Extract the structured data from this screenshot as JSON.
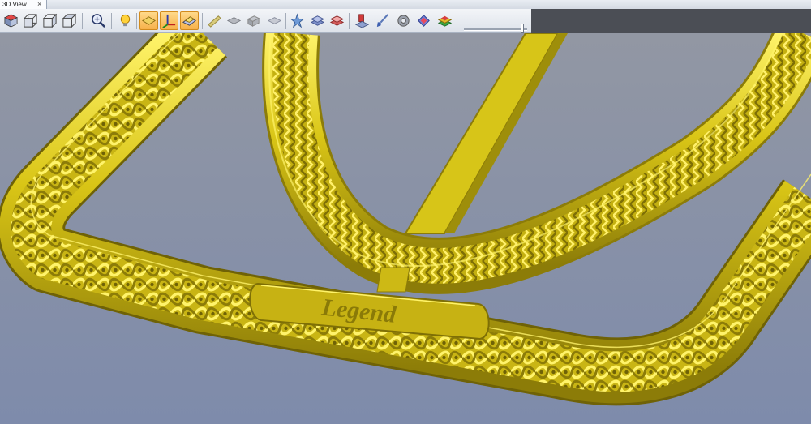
{
  "tabs": [
    {
      "label": "3D View",
      "close": "×"
    }
  ],
  "toolbar": {
    "buttons": [
      {
        "icon": "iso-view-icon",
        "active": false
      },
      {
        "icon": "front-view-icon",
        "active": false
      },
      {
        "icon": "side-view-icon",
        "active": false
      },
      {
        "icon": "top-view-icon",
        "active": false
      },
      {
        "icon": "zoom-icon",
        "active": false
      },
      {
        "icon": "lightbulb-icon",
        "active": false
      },
      {
        "icon": "plane-icon",
        "active": true
      },
      {
        "icon": "axes-icon",
        "active": true
      },
      {
        "icon": "shaded-plane-icon",
        "active": true
      },
      {
        "icon": "blade-icon",
        "active": false
      },
      {
        "icon": "flat-layer-icon",
        "active": false
      },
      {
        "icon": "stack-icon",
        "active": false
      },
      {
        "icon": "layer-icon",
        "active": false
      },
      {
        "icon": "star-icon",
        "active": false
      },
      {
        "icon": "blue-layers-icon",
        "active": false
      },
      {
        "icon": "red-layers-icon",
        "active": false
      },
      {
        "icon": "toolpath-icon",
        "active": false
      },
      {
        "icon": "brush-icon",
        "active": false
      },
      {
        "icon": "cog-icon",
        "active": false
      },
      {
        "icon": "colour-diamond-icon",
        "active": false
      },
      {
        "icon": "layer-colors-icon",
        "active": false
      }
    ],
    "slider_level": 0.95
  },
  "viewport": {
    "background_top": "#9297a3",
    "background_bottom": "#7e8bab",
    "model_color": "#d9c516",
    "model_dark": "#8c7c08",
    "model_light": "#fff36a",
    "engraved_text": "Legend"
  }
}
